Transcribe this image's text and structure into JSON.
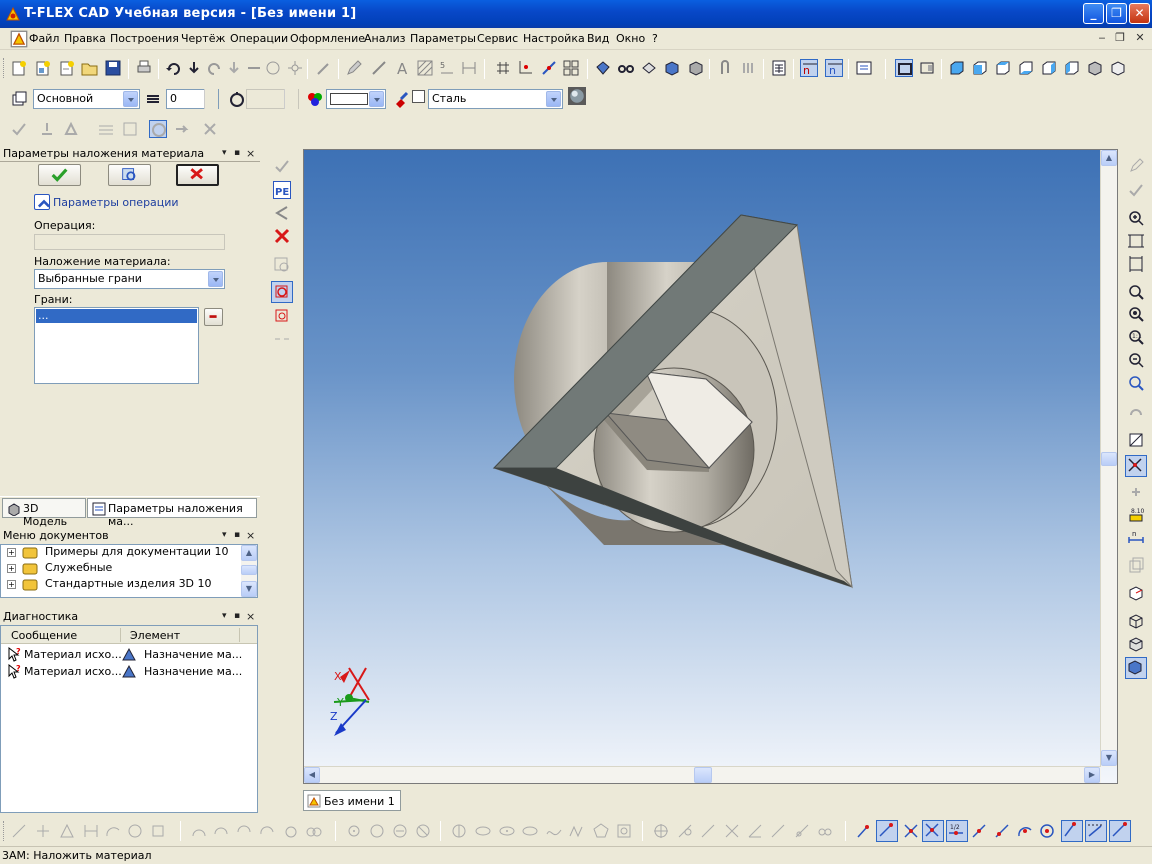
{
  "window": {
    "title": "T-FLEX CAD Учебная версия - [Без имени 1]",
    "minimize": "_",
    "maximize": "❐",
    "close": "✕"
  },
  "menu": [
    "Файл",
    "Правка",
    "Построения",
    "Чертёж",
    "Операции",
    "Оформление",
    "Анализ",
    "Параметры",
    "Сервис",
    "Настройка",
    "Вид",
    "Окно",
    "?"
  ],
  "mdi_controls": [
    "‒",
    "❐",
    "✕"
  ],
  "props_toolbar": {
    "layer": "Основной",
    "level": "0",
    "material": "Сталь"
  },
  "left_panel": {
    "header": "Параметры наложения материала",
    "section_title": "Параметры операции",
    "operation_label": "Операция:",
    "operation_value": "",
    "material_apply_label": "Наложение материала:",
    "material_apply_value": "Выбранные грани",
    "faces_label": "Грани:",
    "faces_items": [
      "..."
    ],
    "tabs": [
      "3D Модель",
      "Параметры наложения ма..."
    ]
  },
  "doc_menu": {
    "header": "Меню документов",
    "items": [
      "Примеры для документации 10",
      "Служебные",
      "Стандартные изделия 3D 10"
    ]
  },
  "diagnostics": {
    "header": "Диагностика",
    "col_message": "Сообщение",
    "col_element": "Элемент",
    "rows": [
      {
        "message": "Материал исхо...",
        "element": "Назначение ма..."
      },
      {
        "message": "Материал исхо...",
        "element": "Назначение ма..."
      }
    ]
  },
  "viewport": {
    "axes": {
      "x": "X",
      "y": "Y",
      "z": "Z"
    },
    "colors": {
      "top": "#3d71b5",
      "bottom": "#f3f6fb"
    }
  },
  "doc_tab": "Без имени 1",
  "status": "3АМ: Наложить материал",
  "colors": {
    "titlebar": "#0848c8",
    "chrome": "#ece9d8",
    "selection": "#316ac5"
  }
}
